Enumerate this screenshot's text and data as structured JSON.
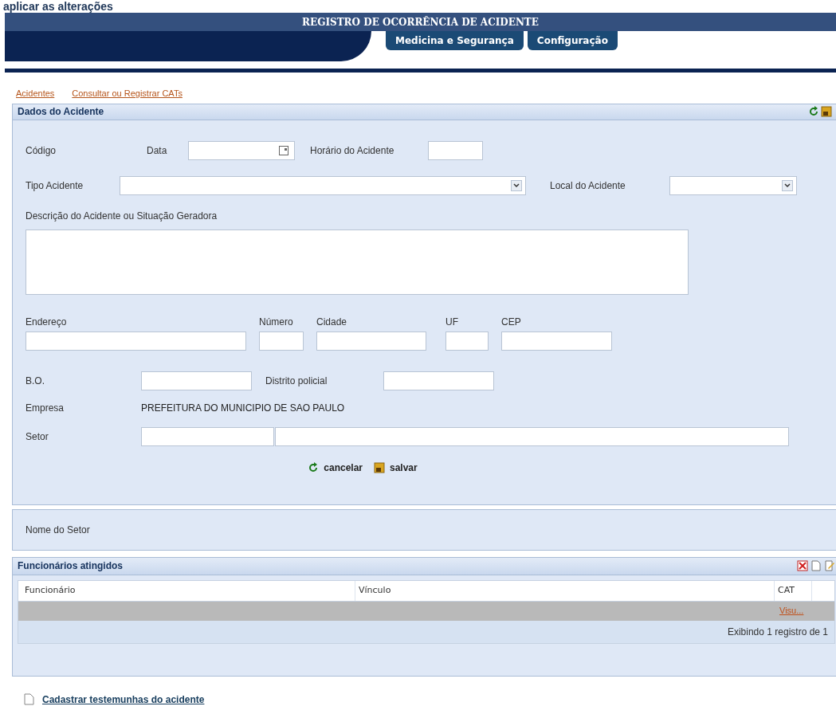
{
  "top_text": "aplicar as alterações",
  "header": {
    "title": "REGISTRO DE OCORRÊNCIA DE ACIDENTE",
    "tabs": [
      "Medicina e Segurança",
      "Configuração"
    ]
  },
  "links": [
    "Acidentes",
    "Consultar ou Registrar CATs"
  ],
  "accident_panel": {
    "title": "Dados do Acidente",
    "fields": {
      "codigo": "Código",
      "data": "Data",
      "horario": "Horário do Acidente",
      "tipo": "Tipo Acidente",
      "local": "Local do Acidente",
      "descricao": "Descrição do Acidente ou Situação Geradora",
      "endereco": "Endereço",
      "numero": "Número",
      "cidade": "Cidade",
      "uf": "UF",
      "cep": "CEP",
      "bo": "B.O.",
      "distrito": "Distrito policial",
      "empresa": "Empresa",
      "setor": "Setor"
    },
    "empresa_value": "PREFEITURA DO MUNICIPIO DE SAO PAULO",
    "buttons": [
      "cancelar",
      "salvar"
    ]
  },
  "sector_panel": {
    "label": "Nome do Setor"
  },
  "employees_panel": {
    "title": "Funcionários atingidos",
    "columns": [
      "Funcionário",
      "Vínculo",
      "CAT"
    ],
    "rows": [
      {
        "selected": true,
        "cat": "Visu..."
      }
    ],
    "footer": "Exibindo 1 registro de 1"
  },
  "bottom_link": "Cadastrar testemunhas do acidente"
}
